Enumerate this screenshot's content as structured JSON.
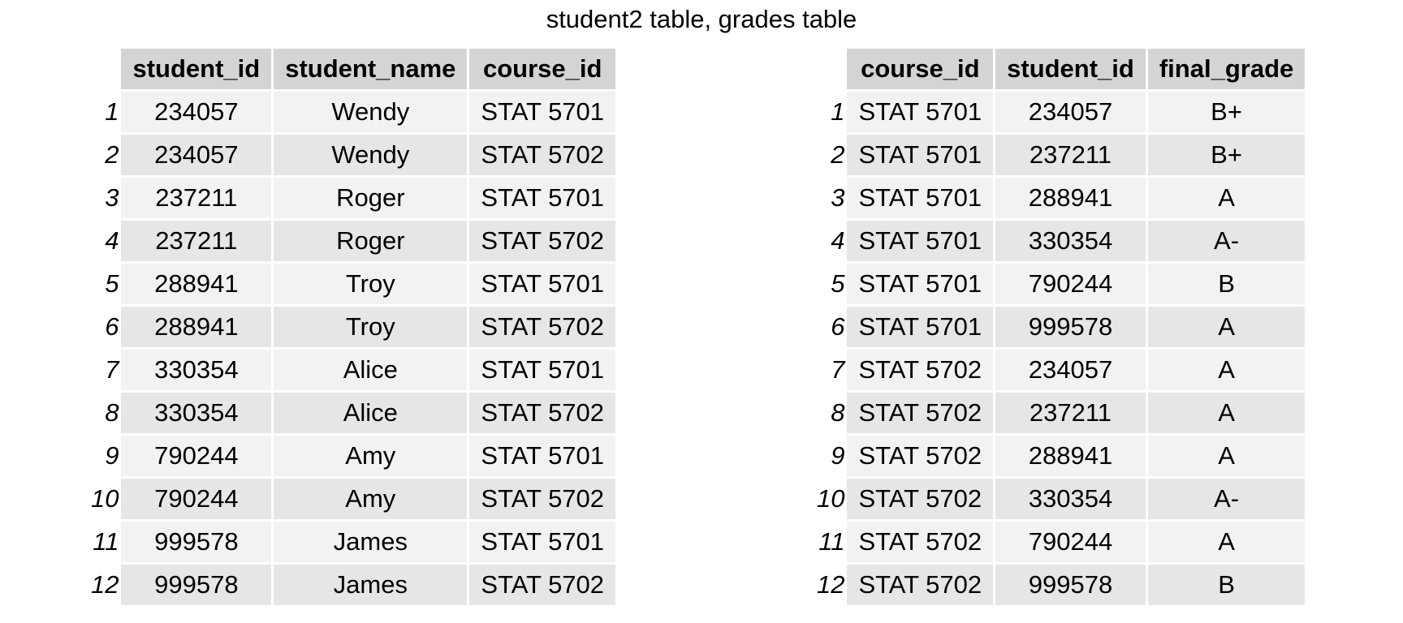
{
  "title": "student2 table, grades table",
  "student2_table": {
    "columns": [
      "student_id",
      "student_name",
      "course_id"
    ],
    "rows": [
      {
        "index": "1",
        "cells": [
          "234057",
          "Wendy",
          "STAT 5701"
        ]
      },
      {
        "index": "2",
        "cells": [
          "234057",
          "Wendy",
          "STAT 5702"
        ]
      },
      {
        "index": "3",
        "cells": [
          "237211",
          "Roger",
          "STAT 5701"
        ]
      },
      {
        "index": "4",
        "cells": [
          "237211",
          "Roger",
          "STAT 5702"
        ]
      },
      {
        "index": "5",
        "cells": [
          "288941",
          "Troy",
          "STAT 5701"
        ]
      },
      {
        "index": "6",
        "cells": [
          "288941",
          "Troy",
          "STAT 5702"
        ]
      },
      {
        "index": "7",
        "cells": [
          "330354",
          "Alice",
          "STAT 5701"
        ]
      },
      {
        "index": "8",
        "cells": [
          "330354",
          "Alice",
          "STAT 5702"
        ]
      },
      {
        "index": "9",
        "cells": [
          "790244",
          "Amy",
          "STAT 5701"
        ]
      },
      {
        "index": "10",
        "cells": [
          "790244",
          "Amy",
          "STAT 5702"
        ]
      },
      {
        "index": "11",
        "cells": [
          "999578",
          "James",
          "STAT 5701"
        ]
      },
      {
        "index": "12",
        "cells": [
          "999578",
          "James",
          "STAT 5702"
        ]
      }
    ]
  },
  "grades_table": {
    "columns": [
      "course_id",
      "student_id",
      "final_grade"
    ],
    "rows": [
      {
        "index": "1",
        "cells": [
          "STAT 5701",
          "234057",
          "B+"
        ]
      },
      {
        "index": "2",
        "cells": [
          "STAT 5701",
          "237211",
          "B+"
        ]
      },
      {
        "index": "3",
        "cells": [
          "STAT 5701",
          "288941",
          "A"
        ]
      },
      {
        "index": "4",
        "cells": [
          "STAT 5701",
          "330354",
          "A-"
        ]
      },
      {
        "index": "5",
        "cells": [
          "STAT 5701",
          "790244",
          "B"
        ]
      },
      {
        "index": "6",
        "cells": [
          "STAT 5701",
          "999578",
          "A"
        ]
      },
      {
        "index": "7",
        "cells": [
          "STAT 5702",
          "234057",
          "A"
        ]
      },
      {
        "index": "8",
        "cells": [
          "STAT 5702",
          "237211",
          "A"
        ]
      },
      {
        "index": "9",
        "cells": [
          "STAT 5702",
          "288941",
          "A"
        ]
      },
      {
        "index": "10",
        "cells": [
          "STAT 5702",
          "330354",
          "A-"
        ]
      },
      {
        "index": "11",
        "cells": [
          "STAT 5702",
          "790244",
          "A"
        ]
      },
      {
        "index": "12",
        "cells": [
          "STAT 5702",
          "999578",
          "B"
        ]
      }
    ]
  }
}
